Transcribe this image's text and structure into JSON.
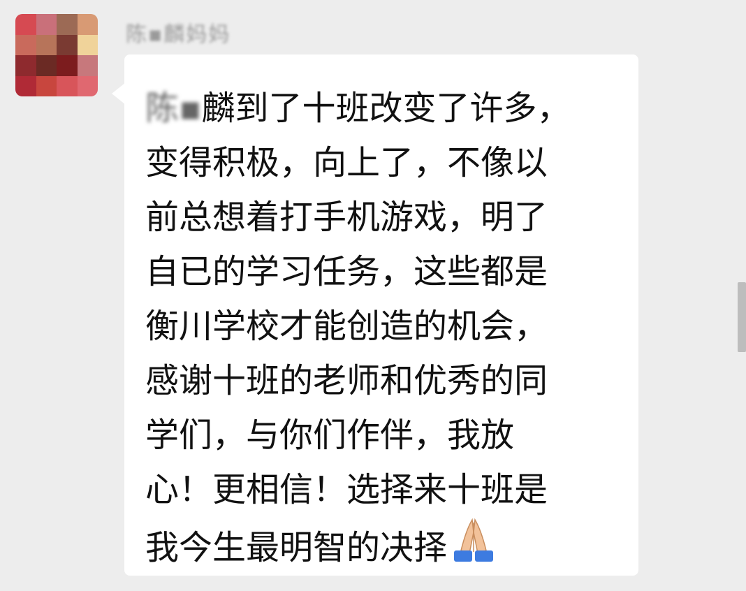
{
  "chat": {
    "sender_name": "陈▪麟妈妈",
    "message": {
      "line1_prefix": "陈",
      "line1_name_redacted": "▪",
      "line1_rest": "麟到了十班改变了许多，",
      "line2": "变得积极，向上了，不像以",
      "line3": "前总想着打手机游戏，明了",
      "line4": "自已的学习任务，这些都是",
      "line5": "衡川学校才能创造的机会，",
      "line6": "感谢十班的老师和优秀的同",
      "line7": "学们，与你们作伴，我放",
      "line8": "心！更相信！选择来十班是",
      "line9": "我今生最明智的决择",
      "emoji": "folded-hands-icon"
    }
  },
  "colors": {
    "background": "#ededed",
    "bubble": "#ffffff",
    "text": "#111111",
    "name": "#9a9a9a"
  }
}
